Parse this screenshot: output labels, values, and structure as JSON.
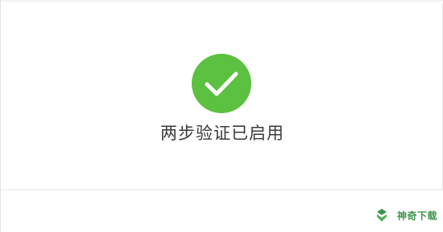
{
  "dialog": {
    "message": "两步验证已启用",
    "status_icon": "check-circle-icon",
    "status_color": "#5cc040"
  },
  "watermark": {
    "text": "神奇下载",
    "icon": "brand-logo-icon",
    "color": "#2a8a3a"
  }
}
